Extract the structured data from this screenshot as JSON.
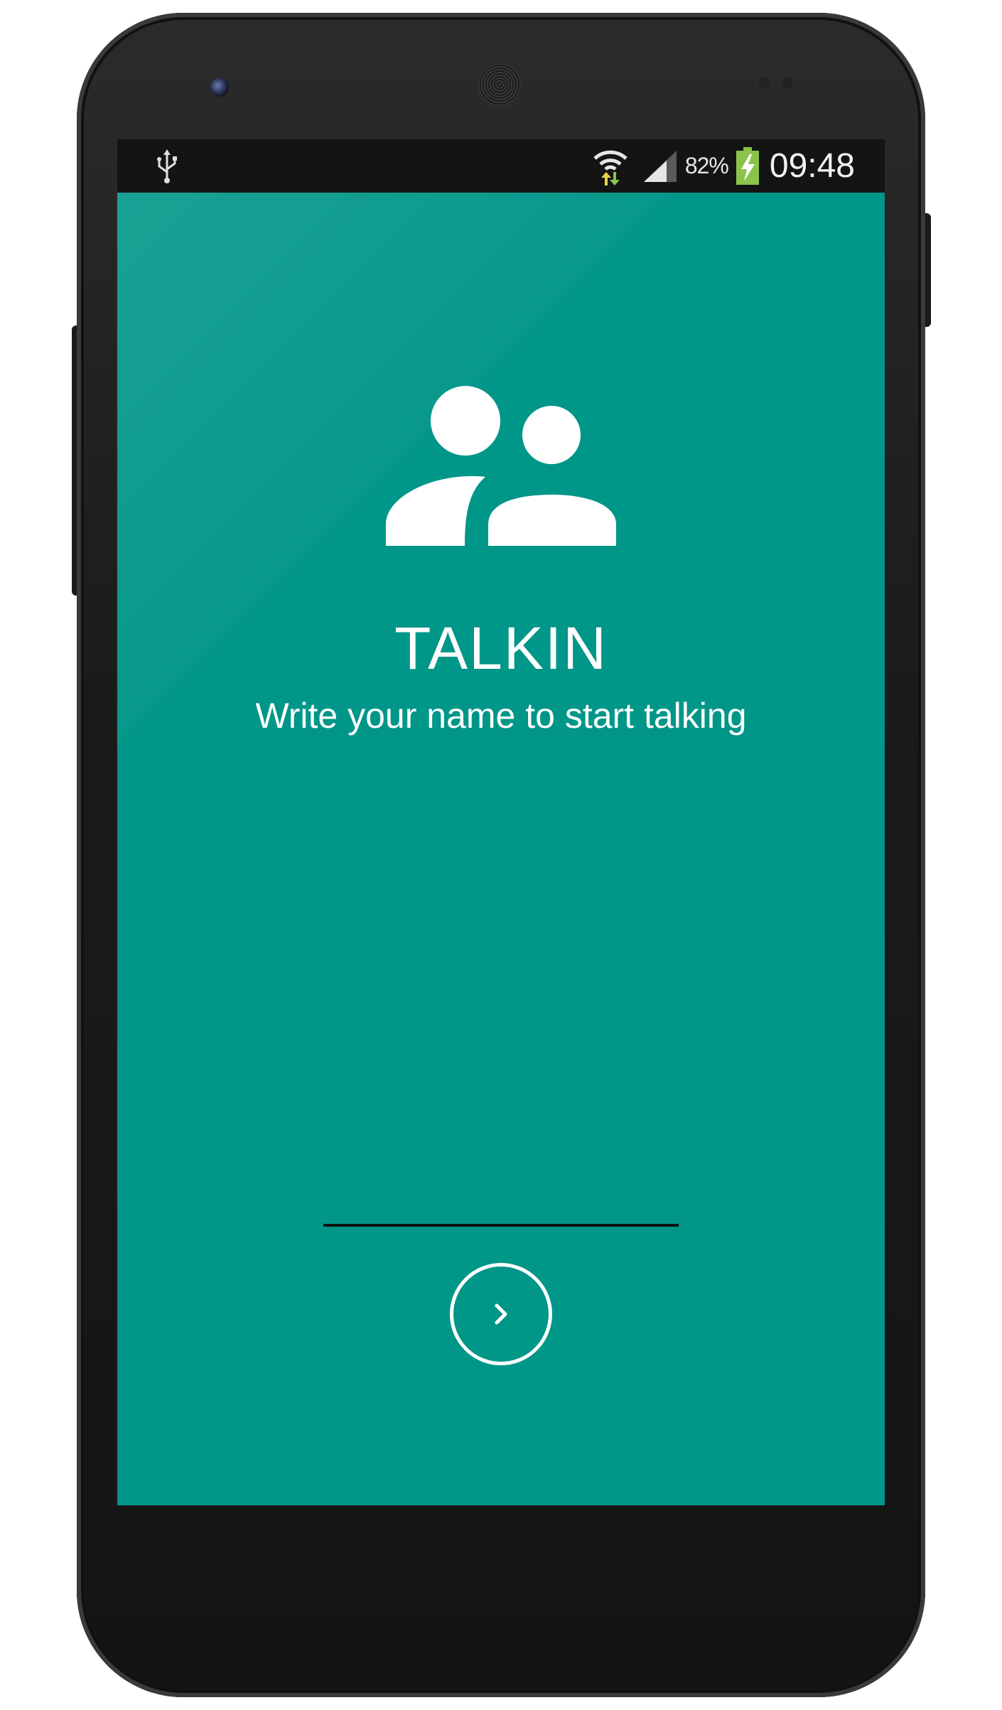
{
  "status_bar": {
    "battery_percent": "82%",
    "time": "09:48",
    "icons": [
      "usb-icon",
      "wifi-data-icon",
      "cell-signal-icon",
      "battery-charging-icon"
    ]
  },
  "app": {
    "logo_icon": "people-icon",
    "title": "TALKIN",
    "subtitle": "Write your name to start talking"
  },
  "login": {
    "name_value": "",
    "next_button_icon": "chevron-right-icon"
  },
  "colors": {
    "background": "#009688",
    "status_bar": "#141414",
    "text": "#ffffff",
    "input_underline": "#111111",
    "battery_fill": "#8bc34a"
  }
}
